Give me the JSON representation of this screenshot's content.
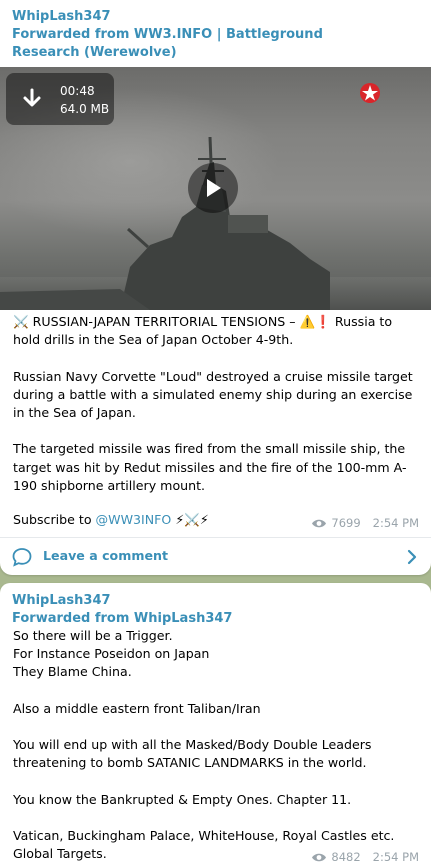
{
  "post1": {
    "sender": "WhipLash347",
    "forwarded_from": "Forwarded from WW3.INFO | Battleground Research (Werewolve)",
    "video": {
      "duration": "00:48",
      "size": "64.0 MB"
    },
    "text_line1_prefix": "⚔️ RUSSIAN-JAPAN TERRITORIAL TENSIONS – ⚠️❗  Russia to hold drills in the Sea of Japan October 4-9th.",
    "text_body": "Russian Navy Corvette \"Loud\" destroyed a cruise missile target during a battle with a simulated enemy ship during an exercise in the Sea of  Japan.\n\nThe targeted missile was fired from the small missile ship, the target was hit by Redut missiles and the fire of the 100-mm A-190 shipborne artillery mount.",
    "subscribe_prefix": "Subscribe to ",
    "subscribe_link": "@WW3INFO",
    "subscribe_suffix": " ⚡⚔️⚡",
    "views": "7699",
    "time": "2:54 PM",
    "comment_label": "Leave a comment"
  },
  "post2": {
    "sender": "WhipLash347",
    "forwarded_from": "Forwarded from WhipLash347",
    "text": "So there will be a Trigger.\nFor Instance Poseidon on Japan\nThey Blame China.\n\nAlso a middle eastern front Taliban/Iran\n\nYou will end up with all the Masked/Body Double Leaders threatening to bomb SATANIC LANDMARKS in the world.\n\nYou know the Bankrupted & Empty Ones. Chapter 11.\n\nVatican, Buckingham Palace, WhiteHouse, Royal Castles etc. Global Targets.",
    "views": "8482",
    "time": "2:54 PM"
  },
  "colors": {
    "accent": "#3a8fb7",
    "background": "#a9b88f",
    "meta": "#9aa4ab"
  },
  "icons": [
    "download-icon",
    "play-icon",
    "zvezda-logo-icon",
    "views-eye-icon",
    "comment-icon",
    "chevron-right-icon"
  ]
}
